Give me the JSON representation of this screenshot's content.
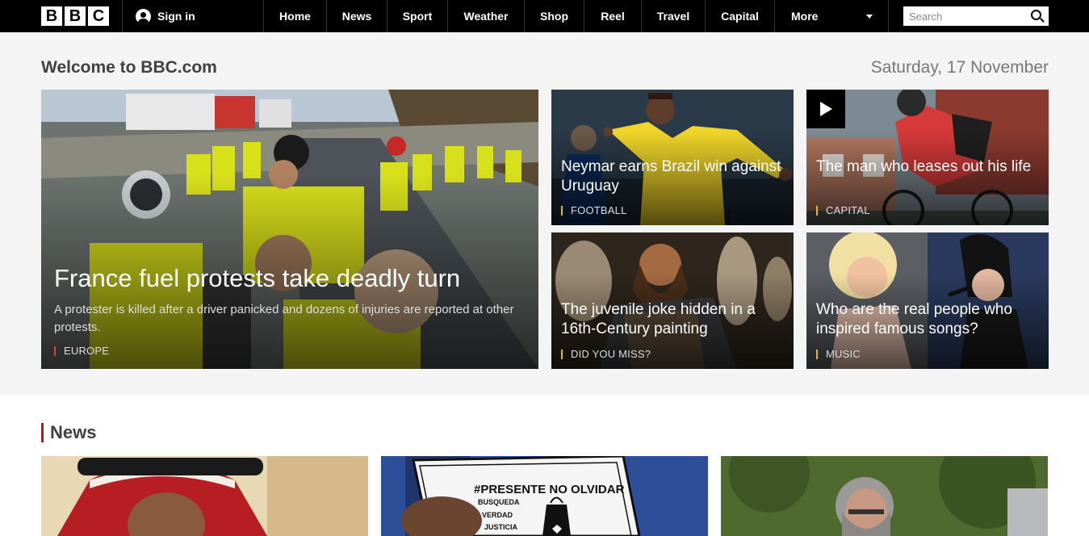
{
  "header": {
    "logo_letters": [
      "B",
      "B",
      "C"
    ],
    "sign_in": "Sign in",
    "nav": [
      "Home",
      "News",
      "Sport",
      "Weather",
      "Shop",
      "Reel",
      "Travel",
      "Capital"
    ],
    "more": "More",
    "search_placeholder": "Search"
  },
  "hero": {
    "welcome": "Welcome to BBC.com",
    "date": "Saturday, 17 November",
    "main": {
      "headline": "France fuel protests take deadly turn",
      "summary": "A protester is killed after a driver panicked and dozens of injuries are reported at other protests.",
      "tag": "EUROPE"
    },
    "stories": [
      {
        "headline": "Neymar earns Brazil win against Uruguay",
        "tag": "FOOTBALL"
      },
      {
        "headline": "The man who leases out his life",
        "tag": "CAPITAL",
        "video": true
      },
      {
        "headline": "The juvenile joke hidden in a 16th-Century painting",
        "tag": "DID YOU MISS?"
      },
      {
        "headline": "Who are the real people who inspired famous songs?",
        "tag": "MUSIC"
      }
    ]
  },
  "news": {
    "title": "News",
    "card2_sign": [
      "#PRESENTE NO OLVIDAR",
      "BUSQUEDA",
      "VERDAD",
      "JUSTICIA"
    ]
  },
  "colors": {
    "nav_bg": "#000000",
    "hero_bg": "#f4f4f4",
    "news_accent": "#bb1919",
    "tag_accent": "#e0c000",
    "europe_accent": "#e04040"
  }
}
